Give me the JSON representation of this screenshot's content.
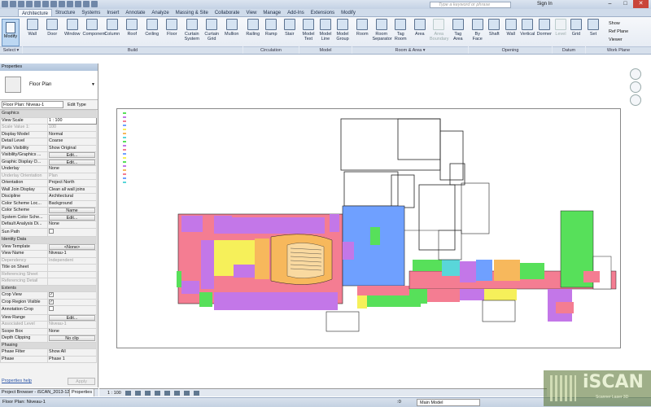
{
  "window": {
    "search_placeholder": "Type a keyword or phrase",
    "sign_in": "Sign In",
    "min": "–",
    "max": "□",
    "close": "✕"
  },
  "tabs": [
    "Architecture",
    "Structure",
    "Systems",
    "Insert",
    "Annotate",
    "Analyze",
    "Massing & Site",
    "Collaborate",
    "View",
    "Manage",
    "Add-Ins",
    "Extensions",
    "Modify"
  ],
  "ribbon": {
    "modify": "Modify",
    "select": "Select ▾",
    "build": [
      {
        "l1": "Wall",
        "l2": ""
      },
      {
        "l1": "Door",
        "l2": ""
      },
      {
        "l1": "Window",
        "l2": ""
      },
      {
        "l1": "Component",
        "l2": ""
      },
      {
        "l1": "Column",
        "l2": ""
      },
      {
        "l1": "Roof",
        "l2": ""
      },
      {
        "l1": "Ceiling",
        "l2": ""
      },
      {
        "l1": "Floor",
        "l2": ""
      },
      {
        "l1": "Curtain",
        "l2": "System"
      },
      {
        "l1": "Curtain",
        "l2": "Grid"
      },
      {
        "l1": "Mullion",
        "l2": ""
      }
    ],
    "circulation": [
      {
        "l1": "Railing",
        "l2": ""
      },
      {
        "l1": "Ramp",
        "l2": ""
      },
      {
        "l1": "Stair",
        "l2": ""
      }
    ],
    "model": [
      {
        "l1": "Model",
        "l2": "Text"
      },
      {
        "l1": "Model",
        "l2": "Line"
      },
      {
        "l1": "Model",
        "l2": "Group"
      }
    ],
    "room": [
      {
        "l1": "Room",
        "l2": ""
      },
      {
        "l1": "Room",
        "l2": "Separator"
      },
      {
        "l1": "Tag",
        "l2": "Room"
      },
      {
        "l1": "Area",
        "l2": ""
      },
      {
        "l1": "Area",
        "l2": "Boundary"
      },
      {
        "l1": "Tag",
        "l2": "Area"
      }
    ],
    "opening": [
      {
        "l1": "By",
        "l2": "Face"
      },
      {
        "l1": "Shaft",
        "l2": ""
      },
      {
        "l1": "Wall",
        "l2": ""
      },
      {
        "l1": "Vertical",
        "l2": ""
      },
      {
        "l1": "Dormer",
        "l2": ""
      }
    ],
    "datum": [
      {
        "l1": "Level",
        "l2": ""
      },
      {
        "l1": "Grid",
        "l2": ""
      }
    ],
    "workplane": {
      "set": "Set",
      "show": "Show",
      "ref_plane": "Ref Plane",
      "viewer": "Viewer"
    },
    "groups": {
      "select": "Select ▾",
      "build": "Build",
      "circulation": "Circulation",
      "model": "Model",
      "room": "Room & Area ▾",
      "opening": "Opening",
      "datum": "Datum",
      "workplane": "Work Plane"
    }
  },
  "properties": {
    "title": "Properties",
    "type_name": "Floor Plan",
    "instance": "Floor Plan: Niveau-1",
    "edit_type": "Edit Type",
    "rows": [
      {
        "g": "Graphics"
      },
      {
        "k": "View Scale",
        "v": "1 : 100",
        "box": true
      },
      {
        "k": "Scale Value  1:",
        "v": "100",
        "dim": true
      },
      {
        "k": "Display Model",
        "v": "Normal"
      },
      {
        "k": "Detail Level",
        "v": "Coarse"
      },
      {
        "k": "Parts Visibility",
        "v": "Show Original"
      },
      {
        "k": "Visibility/Graphics ...",
        "v": "Edit...",
        "btn": true
      },
      {
        "k": "Graphic Display O...",
        "v": "Edit...",
        "btn": true
      },
      {
        "k": "Underlay",
        "v": "None"
      },
      {
        "k": "Underlay Orientation",
        "v": "Plan",
        "dim": true
      },
      {
        "k": "Orientation",
        "v": "Project North"
      },
      {
        "k": "Wall Join Display",
        "v": "Clean all wall joins"
      },
      {
        "k": "Discipline",
        "v": "Architectural"
      },
      {
        "k": "Color Scheme Loc...",
        "v": "Background"
      },
      {
        "k": "Color Scheme",
        "v": "Name",
        "btn": true
      },
      {
        "k": "System Color Sche...",
        "v": "Edit...",
        "btn": true
      },
      {
        "k": "Default Analysis Di...",
        "v": "None"
      },
      {
        "k": "Sun Path",
        "v": "",
        "chk": ""
      },
      {
        "g": "Identity Data"
      },
      {
        "k": "View Template",
        "v": "<None>",
        "btn": true
      },
      {
        "k": "View Name",
        "v": "Niveau-1"
      },
      {
        "k": "Dependency",
        "v": "Independent",
        "dim": true
      },
      {
        "k": "Title on Sheet",
        "v": ""
      },
      {
        "k": "Referencing Sheet",
        "v": "",
        "dim": true
      },
      {
        "k": "Referencing Detail",
        "v": "",
        "dim": true
      },
      {
        "g": "Extents"
      },
      {
        "k": "Crop View",
        "v": "",
        "chk": "✓"
      },
      {
        "k": "Crop Region Visible",
        "v": "",
        "chk": "✓"
      },
      {
        "k": "Annotation Crop",
        "v": "",
        "chk": ""
      },
      {
        "k": "View Range",
        "v": "Edit...",
        "btn": true
      },
      {
        "k": "Associated Level",
        "v": "Niveau-1",
        "dim": true
      },
      {
        "k": "Scope Box",
        "v": "None"
      },
      {
        "k": "Depth Clipping",
        "v": "No clip",
        "btn": true
      },
      {
        "g": "Phasing"
      },
      {
        "k": "Phase Filter",
        "v": "Show All"
      },
      {
        "k": "Phase",
        "v": "Phase 1"
      }
    ],
    "help": "Properties help",
    "apply": "Apply"
  },
  "panel_tabs": [
    "Project Browser - iSCAN_2013-12...",
    "Properties"
  ],
  "view": {
    "scale": "1 : 100"
  },
  "status": {
    "text": "Floor Plan: Niveau-1",
    "workset": "Main Model",
    "zero": ":0"
  },
  "logo": {
    "brand": "iSCAN",
    "sub": "Scanner Laser 3D"
  },
  "colors": {
    "pink": "#f47d92",
    "purple": "#c377e8",
    "blue": "#6fa0ff",
    "green": "#57e05a",
    "yellow": "#f6f05a",
    "orange": "#f7b85c",
    "cyan": "#59d6d9"
  }
}
